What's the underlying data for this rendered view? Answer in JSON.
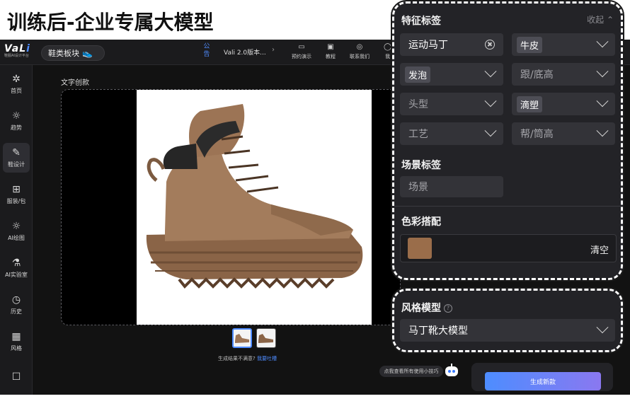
{
  "slide": {
    "title": "训练后-企业专属大模型"
  },
  "header": {
    "logo_text": "VaLi",
    "logo_sub": "鞋服AI设计平台",
    "module": "鞋类板块",
    "notice_label": "公告",
    "notice_text": "Vali 2.0版本...",
    "links": [
      "预约演示",
      "教程",
      "联系我们",
      "我"
    ]
  },
  "sidebar": {
    "items": [
      {
        "label": "首页",
        "icon": "sparkle-icon"
      },
      {
        "label": "趋势",
        "icon": "bulb-icon"
      },
      {
        "label": "鞋设计",
        "icon": "pen-icon"
      },
      {
        "label": "服装/包",
        "icon": "shirt-icon"
      },
      {
        "label": "AI绘图",
        "icon": "bulb-icon"
      },
      {
        "label": "AI实验室",
        "icon": "flask-icon"
      },
      {
        "label": "历史",
        "icon": "history-icon"
      },
      {
        "label": "风格",
        "icon": "style-icon"
      },
      {
        "label": "",
        "icon": "edit-icon"
      }
    ]
  },
  "workspace": {
    "label": "文字创款",
    "feedback_text": "生成结果不满意?",
    "feedback_link": "我要吐槽",
    "tip": "点我查看所有使用小技巧",
    "generate_label": "生成新款"
  },
  "features": {
    "title": "特征标签",
    "collapse": "收起",
    "fields": [
      {
        "text": "运动马丁",
        "kind": "value"
      },
      {
        "text": "牛皮",
        "kind": "chip"
      },
      {
        "text": "发泡",
        "kind": "chip"
      },
      {
        "text": "跟/底高",
        "kind": "placeholder"
      },
      {
        "text": "头型",
        "kind": "placeholder"
      },
      {
        "text": "滴塑",
        "kind": "chip"
      },
      {
        "text": "工艺",
        "kind": "placeholder"
      },
      {
        "text": "帮/筒高",
        "kind": "placeholder"
      }
    ],
    "scene_title": "场景标签",
    "scene_placeholder": "场景",
    "color_title": "色彩搭配",
    "color_clear": "清空",
    "swatch_color": "#9a6d4a"
  },
  "style_model": {
    "title": "风格模型",
    "value": "马丁靴大模型"
  }
}
